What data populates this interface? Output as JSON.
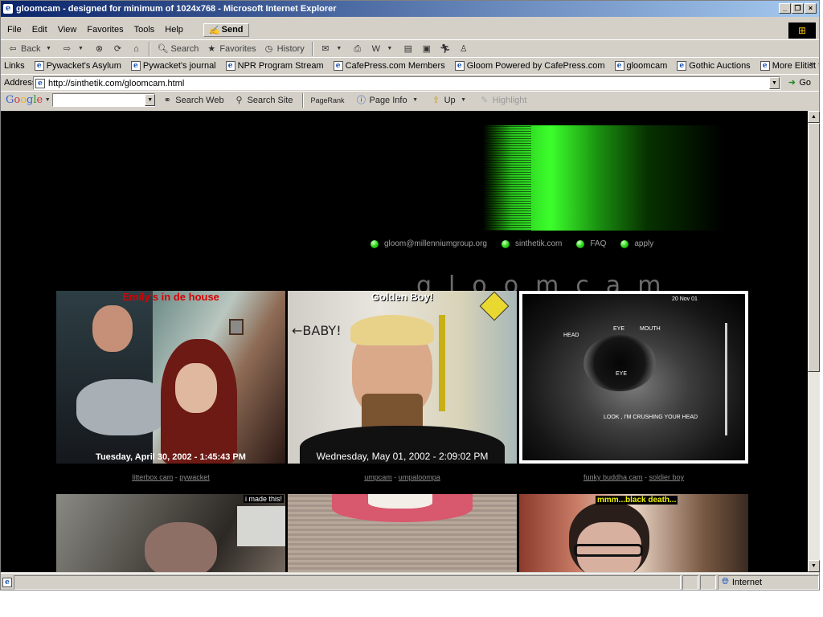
{
  "window": {
    "title": "gloomcam - designed for minimum of 1024x768 - Microsoft Internet Explorer"
  },
  "menu": {
    "items": [
      "File",
      "Edit",
      "View",
      "Favorites",
      "Tools",
      "Help"
    ],
    "send_label": "Send"
  },
  "toolbar": {
    "back": "Back",
    "search": "Search",
    "favorites": "Favorites",
    "history": "History"
  },
  "links_bar": {
    "label": "Links",
    "items": [
      "Pywacket's Asylum",
      "Pywacket's journal",
      "NPR Program Stream",
      "CafePress.com Members",
      "Gloom Powered by CafePress.com",
      "gloomcam",
      "Gothic Auctions",
      "More Elitist than YOU!"
    ]
  },
  "address": {
    "label": "Address",
    "url": "http://sinthetik.com/gloomcam.html",
    "go": "Go"
  },
  "google_bar": {
    "logo": "Google",
    "search_web": "Search Web",
    "search_site": "Search Site",
    "pagerank": "PageRank",
    "page_info": "Page Info",
    "up": "Up",
    "highlight": "Highlight"
  },
  "page": {
    "logo": "gloomcam",
    "nav": [
      "gloom@millenniumgroup.org",
      "sinthetik.com",
      "FAQ",
      "apply"
    ],
    "cams": [
      {
        "caption": "Emily's in de house",
        "timestamp": "Tuesday, April 30, 2002 - 1:45:43 PM",
        "cam_name": "litterbox cam",
        "owner": "pywacket"
      },
      {
        "caption": "Golden Boy!",
        "timestamp": "Wednesday, May 01, 2002 - 2:09:02 PM",
        "cam_name": "umpcam",
        "owner": "umpaloompa",
        "sign": "←BABY!"
      },
      {
        "caption": "",
        "timestamp": "",
        "cam_name": "funky buddha cam",
        "owner": "soldier boy",
        "us_labels": {
          "head": "HEAD",
          "eye1": "EYE",
          "mouth": "MOUTH",
          "eye2": "EYE",
          "look": "LOOK , I'M CRUSHING YOUR HEAD",
          "date": "20 Nov 01"
        }
      },
      {
        "caption": "i made this!"
      },
      {
        "caption": ""
      },
      {
        "caption": "mmm...black death..."
      }
    ]
  },
  "status": {
    "zone": "Internet"
  },
  "colors": {
    "title_start": "#0a246a",
    "title_end": "#a6caf0",
    "chrome": "#d4d0c8",
    "banner_green": "#3cff2c",
    "caption_red": "#d80000",
    "caption_yellow": "#f2f200"
  }
}
